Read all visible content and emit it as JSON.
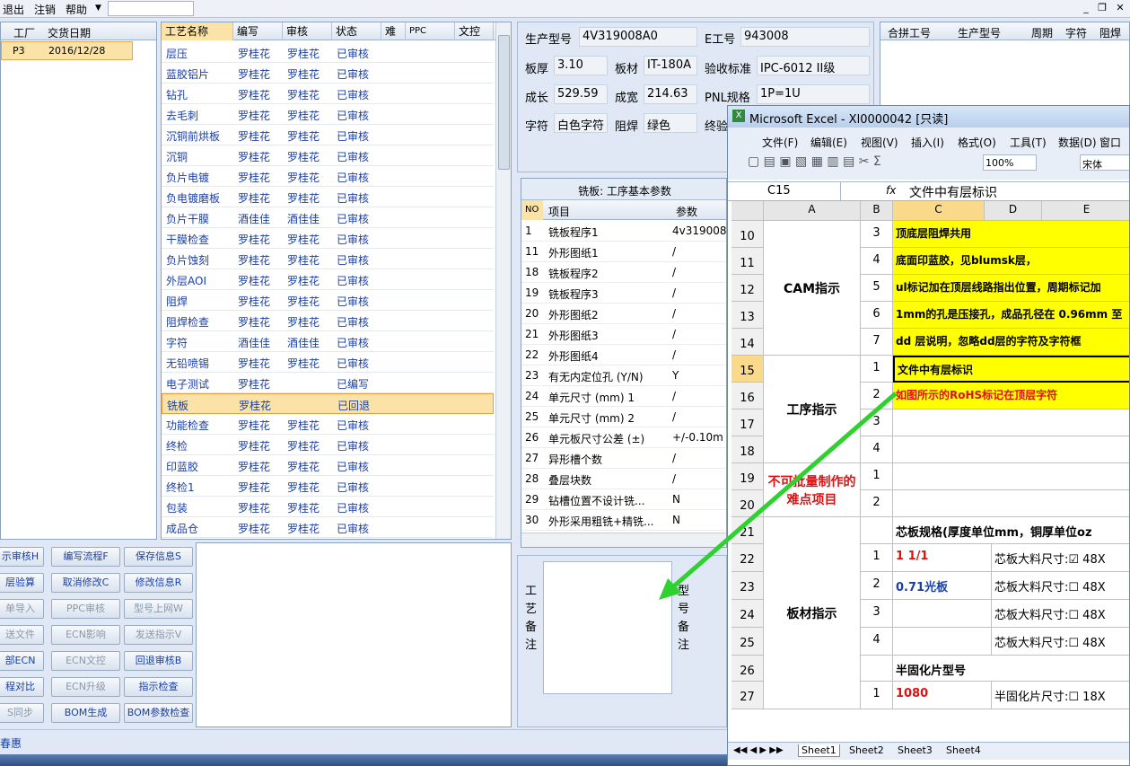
{
  "menubar": {
    "exit": "退出",
    "logout": "注销",
    "help": "帮助"
  },
  "left": {
    "headers": [
      "工厂",
      "交货日期"
    ],
    "row": {
      "factory": "P3",
      "date": "2016/12/28"
    }
  },
  "grid": {
    "headers": [
      "工艺名称",
      "编写",
      "审核",
      "状态",
      "难",
      "PPC",
      "文控"
    ],
    "rows": [
      [
        "层压",
        "罗桂花",
        "罗桂花",
        "已审核"
      ],
      [
        "蓝胶铝片",
        "罗桂花",
        "罗桂花",
        "已审核"
      ],
      [
        "钻孔",
        "罗桂花",
        "罗桂花",
        "已审核"
      ],
      [
        "去毛刺",
        "罗桂花",
        "罗桂花",
        "已审核"
      ],
      [
        "沉铜前烘板",
        "罗桂花",
        "罗桂花",
        "已审核"
      ],
      [
        "沉铜",
        "罗桂花",
        "罗桂花",
        "已审核"
      ],
      [
        "负片电镀",
        "罗桂花",
        "罗桂花",
        "已审核"
      ],
      [
        "负电镀磨板",
        "罗桂花",
        "罗桂花",
        "已审核"
      ],
      [
        "负片干膜",
        "酒佳佳",
        "酒佳佳",
        "已审核"
      ],
      [
        "干膜检查",
        "罗桂花",
        "罗桂花",
        "已审核"
      ],
      [
        "负片蚀刻",
        "罗桂花",
        "罗桂花",
        "已审核"
      ],
      [
        "外层AOI",
        "罗桂花",
        "罗桂花",
        "已审核"
      ],
      [
        "阻焊",
        "罗桂花",
        "罗桂花",
        "已审核"
      ],
      [
        "阻焊检查",
        "罗桂花",
        "罗桂花",
        "已审核"
      ],
      [
        "字符",
        "酒佳佳",
        "酒佳佳",
        "已审核"
      ],
      [
        "无铅喷锡",
        "罗桂花",
        "罗桂花",
        "已审核"
      ],
      [
        "电子测试",
        "罗桂花",
        "",
        "已编写"
      ],
      [
        "铣板",
        "罗桂花",
        "",
        "已回退"
      ],
      [
        "功能检查",
        "罗桂花",
        "罗桂花",
        "已审核"
      ],
      [
        "终检",
        "罗桂花",
        "罗桂花",
        "已审核"
      ],
      [
        "印蓝胶",
        "罗桂花",
        "罗桂花",
        "已审核"
      ],
      [
        "终检1",
        "罗桂花",
        "罗桂花",
        "已审核"
      ],
      [
        "包装",
        "罗桂花",
        "罗桂花",
        "已审核"
      ],
      [
        "成品仓",
        "罗桂花",
        "罗桂花",
        "已审核"
      ]
    ],
    "selected_index": 17
  },
  "buttons": [
    [
      "示审核H",
      "编写流程F",
      "保存信息S"
    ],
    [
      "层验算",
      "取消修改C",
      "修改信息R"
    ],
    [
      "单导入",
      "PPC审核",
      "型号上网W"
    ],
    [
      "送文件",
      "ECN影响",
      "发送指示V"
    ],
    [
      "部ECN",
      "ECN文控",
      "回退审核B"
    ],
    [
      "程对比",
      "ECN升级",
      "指示检查"
    ],
    [
      "S同步",
      "BOM生成",
      "BOM参数检查"
    ]
  ],
  "disabled_buttons": [
    "单导入",
    "PPC审核",
    "型号上网W",
    "送文件",
    "ECN影响",
    "发送指示V",
    "ECN文控",
    "ECN升级",
    "S同步"
  ],
  "status": {
    "text": "春惠"
  },
  "info": {
    "model_label": "生产型号",
    "model": "4V319008A0",
    "eno_label": "E工号",
    "eno": "943008",
    "thick_label": "板厚",
    "thick": "3.10",
    "mat_label": "板材",
    "mat": "IT-180A",
    "std_label": "验收标准",
    "std": "IPC-6012 II级",
    "len_label": "成长",
    "len": "529.59",
    "wid_label": "成宽",
    "wid": "214.63",
    "pnl_label": "PNL规格",
    "pnl": "1P=1U",
    "char_label": "字符",
    "char": "白色字符",
    "mask_label": "阻焊",
    "mask": "绿色",
    "final_label": "终验"
  },
  "rightgrid": {
    "headers": [
      "合拼工号",
      "生产型号",
      "周期",
      "字符",
      "阻焊"
    ]
  },
  "params": {
    "title": "铣板: 工序基本参数",
    "headers": [
      "NO",
      "项目",
      "参数"
    ],
    "rows": [
      [
        "1",
        "铣板程序1",
        "4v319008"
      ],
      [
        "11",
        "外形图纸1",
        "/"
      ],
      [
        "18",
        "铣板程序2",
        "/"
      ],
      [
        "19",
        "铣板程序3",
        "/"
      ],
      [
        "20",
        "外形图纸2",
        "/"
      ],
      [
        "21",
        "外形图纸3",
        "/"
      ],
      [
        "22",
        "外形图纸4",
        "/"
      ],
      [
        "23",
        "有无内定位孔 (Y/N)",
        "Y"
      ],
      [
        "24",
        "单元尺寸 (mm) 1",
        "/"
      ],
      [
        "25",
        "单元尺寸 (mm) 2",
        "/"
      ],
      [
        "26",
        "单元板尺寸公差 (±)",
        "+/-0.10m"
      ],
      [
        "27",
        "异形槽个数",
        "/"
      ],
      [
        "28",
        "叠层块数",
        "/"
      ],
      [
        "29",
        "钻槽位置不设计铣...",
        "N"
      ],
      [
        "30",
        "外形采用粗铣+精铣...",
        "N"
      ]
    ]
  },
  "remarks": {
    "label1": "工艺备注",
    "label2": "型号备注"
  },
  "excel": {
    "title": "Microsoft Excel - Xl0000042 [只读]",
    "menus": [
      "文件(F)",
      "编辑(E)",
      "视图(V)",
      "插入(I)",
      "格式(O)",
      "工具(T)",
      "数据(D)",
      "窗口"
    ],
    "zoom": "100%",
    "font": "宋体",
    "cellref": "C15",
    "formula": "文件中有层标识",
    "col_headers": [
      "A",
      "B",
      "C",
      "D",
      "E"
    ],
    "rows": [
      {
        "r": "10",
        "b": "3",
        "c": "顶底层阻焊共用",
        "yel": true
      },
      {
        "r": "11",
        "b": "4",
        "c": "底面印蓝胶，见blumsk层，",
        "yel": true
      },
      {
        "r": "12",
        "b": "5",
        "c": "ul标记加在顶层线路指出位置，周期标记加",
        "yel": true
      },
      {
        "r": "13",
        "b": "6",
        "c": "1mm的孔是压接孔，成品孔径在 0.96mm 至",
        "yel": true
      },
      {
        "r": "14",
        "b": "7",
        "c": "dd 层说明，忽略dd层的字符及字符框",
        "yel": true
      },
      {
        "r": "15",
        "b": "1",
        "c": "文件中有层标识",
        "yel": true
      },
      {
        "r": "16",
        "b": "2",
        "c": "如图所示的RoHS标记在顶层字符",
        "yel": true,
        "red": true
      },
      {
        "r": "17",
        "b": "3",
        "c": ""
      },
      {
        "r": "18",
        "b": "4",
        "c": ""
      },
      {
        "r": "19",
        "b": "1",
        "c": ""
      },
      {
        "r": "20",
        "b": "2",
        "c": ""
      },
      {
        "r": "21",
        "b": "",
        "c": "芯板规格(厚度单位mm，铜厚单位oz"
      },
      {
        "r": "22",
        "b": "1",
        "c": "1      1/1",
        "d": "芯板大料尺寸:☑ 48X"
      },
      {
        "r": "23",
        "b": "2",
        "c": "0.71光板",
        "d": "芯板大料尺寸:☐ 48X"
      },
      {
        "r": "24",
        "b": "3",
        "c": "",
        "d": "芯板大料尺寸:☐ 48X"
      },
      {
        "r": "25",
        "b": "4",
        "c": "",
        "d": "芯板大料尺寸:☐ 48X"
      },
      {
        "r": "26",
        "b": "",
        "c": "半固化片型号"
      },
      {
        "r": "27",
        "b": "1",
        "c": "1080",
        "d": "半固化片尺寸:☐ 18X"
      }
    ],
    "group_labels": {
      "cam": "CAM指示",
      "proc": "工序指示",
      "hard": "不可批量制作的难点项目",
      "board": "板材指示"
    },
    "tabs": [
      "Sheet1",
      "Sheet2",
      "Sheet3",
      "Sheet4"
    ]
  }
}
